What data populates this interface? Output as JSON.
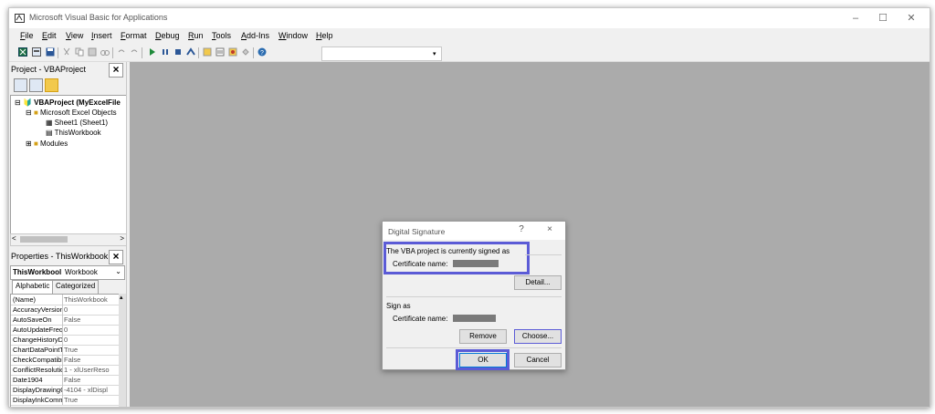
{
  "window": {
    "title": "Microsoft Visual Basic for Applications"
  },
  "menu": [
    "File",
    "Edit",
    "View",
    "Insert",
    "Format",
    "Debug",
    "Run",
    "Tools",
    "Add-Ins",
    "Window",
    "Help"
  ],
  "project_panel": {
    "title": "Project - VBAProject",
    "close_label": "x",
    "tree": {
      "root": "VBAProject (MyExcelFile",
      "folder_objects": "Microsoft Excel Objects",
      "sheet": "Sheet1 (Sheet1)",
      "workbook": "ThisWorkbook",
      "modules": "Modules"
    },
    "scroll_left": "<",
    "scroll_right": ">"
  },
  "properties_panel": {
    "title": "Properties - ThisWorkbook",
    "combo_name": "ThisWorkbool",
    "combo_type": "Workbook",
    "tabs": [
      "Alphabetic",
      "Categorized"
    ],
    "rows": [
      {
        "name": "(Name)",
        "value": "ThisWorkbook"
      },
      {
        "name": "AccuracyVersion",
        "value": "0"
      },
      {
        "name": "AutoSaveOn",
        "value": "False"
      },
      {
        "name": "AutoUpdateFreq",
        "value": "0"
      },
      {
        "name": "ChangeHistoryD",
        "value": "0"
      },
      {
        "name": "ChartDataPointT",
        "value": "True"
      },
      {
        "name": "CheckCompatibi",
        "value": "False"
      },
      {
        "name": "ConflictResolutio",
        "value": "1 - xlUserReso"
      },
      {
        "name": "Date1904",
        "value": "False"
      },
      {
        "name": "DisplayDrawingC",
        "value": "-4104 - xlDispl"
      },
      {
        "name": "DisplayInkComm",
        "value": "True"
      }
    ]
  },
  "dialog": {
    "title": "Digital Signature",
    "help": "?",
    "close": "×",
    "signed_text": "The VBA project is currently signed as",
    "cert_label_1": "Certificate name:",
    "detail_button": "Detail...",
    "sign_as_label": "Sign as",
    "cert_label_2": "Certificate name:",
    "remove_button": "Remove",
    "choose_button": "Choose...",
    "ok_button": "OK",
    "cancel_button": "Cancel"
  },
  "colors": {
    "highlight": "#5b5bd6",
    "workspace": "#ababab"
  }
}
